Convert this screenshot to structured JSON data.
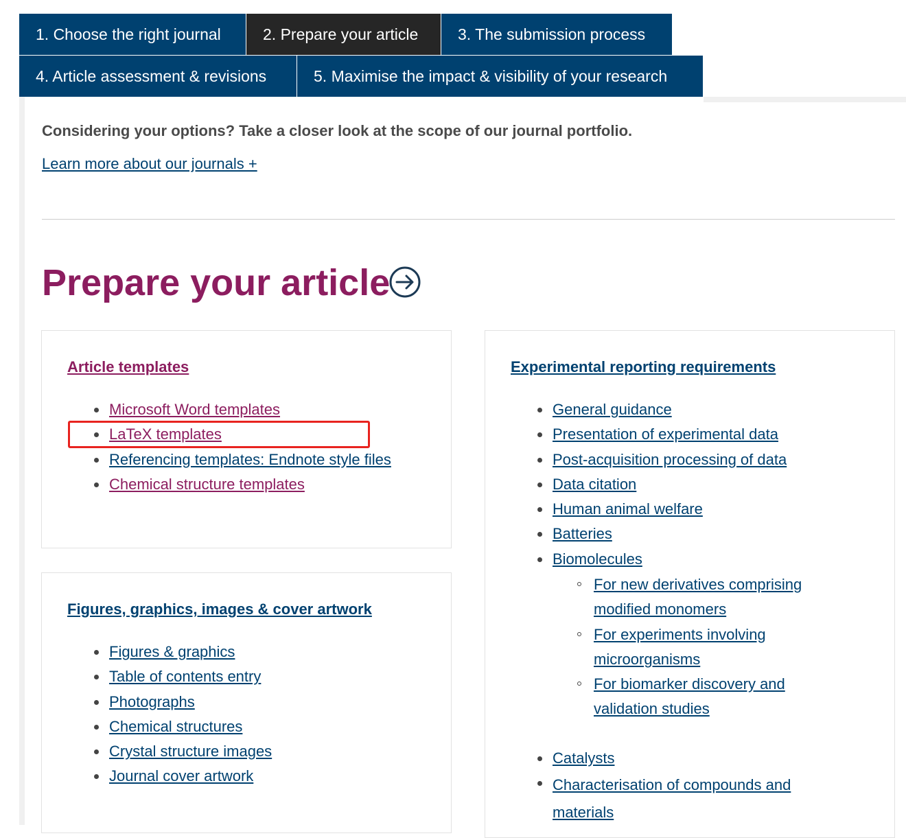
{
  "tabs": [
    {
      "label": "1. Choose the right journal"
    },
    {
      "label": "2. Prepare your article",
      "active": true
    },
    {
      "label": "3. The submission process"
    },
    {
      "label": "4. Article assessment & revisions"
    },
    {
      "label": "5. Maximise the impact & visibility of your research"
    }
  ],
  "intro": {
    "text": "Considering your options? Take a closer look at the scope of our journal portfolio.",
    "link": "Learn more about our journals +"
  },
  "page_title": "Prepare your article",
  "article_templates": {
    "title": "Article templates",
    "items": [
      "Microsoft Word templates",
      "LaTeX templates",
      "Referencing templates: Endnote style files",
      "Chemical structure templates"
    ]
  },
  "figures": {
    "title": "Figures, graphics, images & cover artwork",
    "items": [
      "Figures & graphics",
      "Table of contents entry",
      "Photographs",
      "Chemical structures",
      "Crystal structure images",
      "Journal cover artwork"
    ]
  },
  "experimental": {
    "title": "Experimental reporting requirements",
    "items": [
      "General guidance",
      "Presentation of experimental data",
      "Post-acquisition processing of data",
      "Data citation",
      "Human animal welfare",
      "Batteries",
      "Biomolecules"
    ],
    "biomolecules_sub": [
      "For new derivatives comprising modified monomers",
      "For experiments involving microorganisms",
      "For biomarker discovery and validation studies"
    ],
    "items_after": [
      "Catalysts",
      "Characterisation of compounds and materials"
    ]
  },
  "colors": {
    "tab_bg": "#004170",
    "tab_active_bg": "#262626",
    "title_magenta": "#8c1d5f",
    "link_blue": "#004170",
    "highlight_red": "#e8231f"
  }
}
